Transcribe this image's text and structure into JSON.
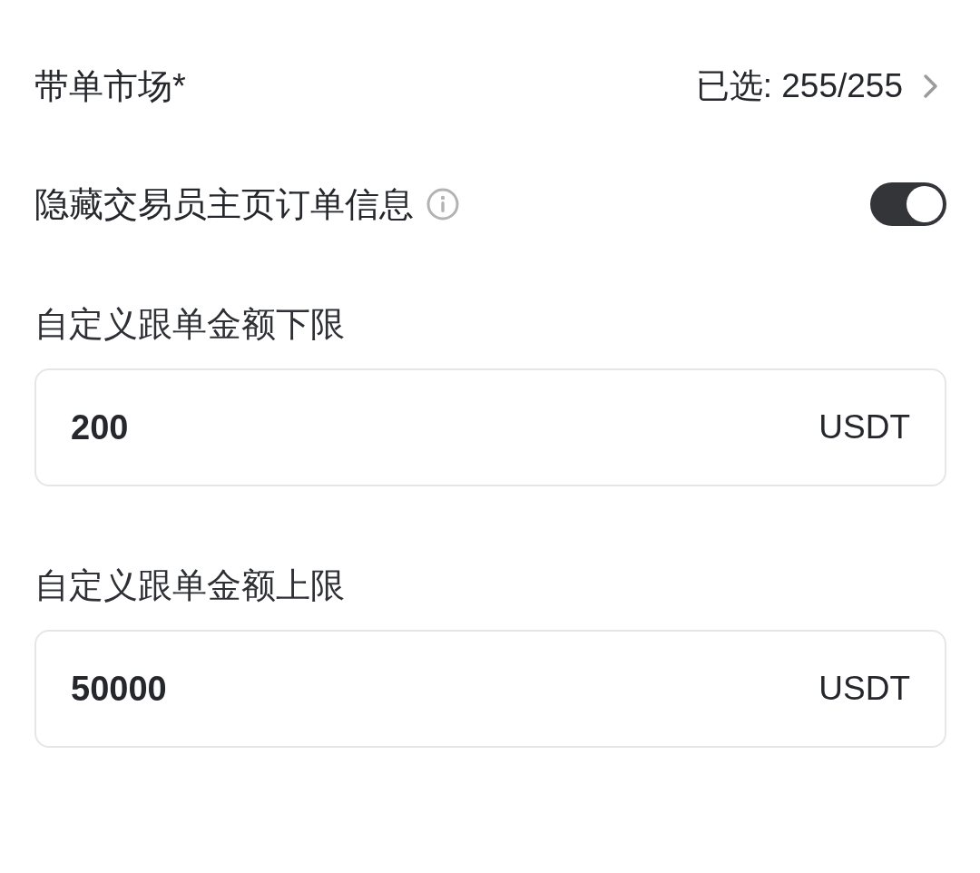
{
  "market": {
    "label": "带单市场*",
    "value": "已选: 255/255"
  },
  "hide_orders": {
    "label": "隐藏交易员主页订单信息",
    "on": true
  },
  "fields": [
    {
      "label": "自定义跟单金额下限",
      "value": "200",
      "unit": "USDT"
    },
    {
      "label": "自定义跟单金额上限",
      "value": "50000",
      "unit": "USDT"
    }
  ]
}
